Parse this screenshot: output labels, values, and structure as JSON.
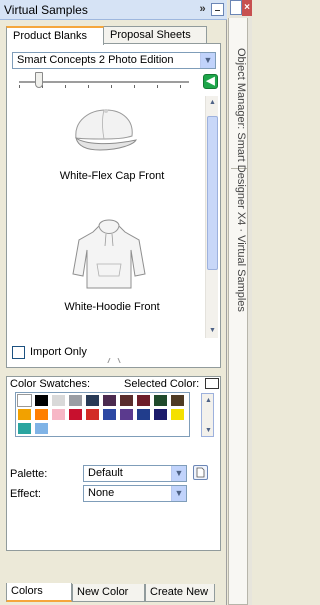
{
  "panel": {
    "title": "Virtual Samples",
    "collapse_glyph": "»"
  },
  "tabs": [
    {
      "label": "Product Blanks",
      "active": true
    },
    {
      "label": "Proposal Sheets",
      "active": false
    }
  ],
  "product_select": {
    "value": "Smart Concepts 2 Photo Edition"
  },
  "slider": {
    "value_fraction": 0.12
  },
  "go_button": {
    "glyph": "◀",
    "icon": "go-arrow-icon"
  },
  "items": [
    {
      "label": "White-Flex Cap Front",
      "icon": "cap-thumbnail"
    },
    {
      "label": "White-Hoodie Front",
      "icon": "hoodie-thumbnail"
    }
  ],
  "import_only": {
    "label": "Import Only",
    "checked": false
  },
  "swatches": {
    "label": "Color Swatches:",
    "selected_label": "Selected Color:",
    "selected_color": "#ffffff",
    "colors": [
      "#ffffff",
      "#000000",
      "#d9d9d9",
      "#9b9ea4",
      "#283a56",
      "#4b2a4f",
      "#5a2d2d",
      "#6e1e2a",
      "#1f4a2b",
      "#4f3b24",
      "#f2a100",
      "#ff7f00",
      "#f7b7c6",
      "#c8102e",
      "#d22c26",
      "#2c48a4",
      "#5b3a8e",
      "#213d8c",
      "#1b1b6b",
      "#f4e000",
      "#2aa5a0",
      "#7fb3e6"
    ]
  },
  "palette": {
    "label": "Palette:",
    "value": "Default"
  },
  "effect": {
    "label": "Effect:",
    "value": "None"
  },
  "bottom_tabs": [
    {
      "label": "Colors",
      "active": true
    },
    {
      "label": "New Color",
      "active": false
    },
    {
      "label": "Create New",
      "active": false
    }
  ],
  "side_strip": {
    "vertical_tabs_text": "Object Manager: Smart Designer X4 · Virtual Samples",
    "close_glyph": "×"
  }
}
